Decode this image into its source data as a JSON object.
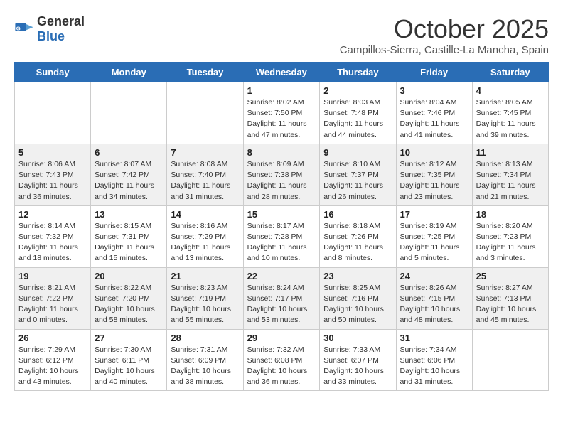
{
  "header": {
    "logo_general": "General",
    "logo_blue": "Blue",
    "month": "October 2025",
    "subtitle": "Campillos-Sierra, Castille-La Mancha, Spain"
  },
  "days_of_week": [
    "Sunday",
    "Monday",
    "Tuesday",
    "Wednesday",
    "Thursday",
    "Friday",
    "Saturday"
  ],
  "weeks": [
    [
      {
        "day": "",
        "info": ""
      },
      {
        "day": "",
        "info": ""
      },
      {
        "day": "",
        "info": ""
      },
      {
        "day": "1",
        "info": "Sunrise: 8:02 AM\nSunset: 7:50 PM\nDaylight: 11 hours and 47 minutes."
      },
      {
        "day": "2",
        "info": "Sunrise: 8:03 AM\nSunset: 7:48 PM\nDaylight: 11 hours and 44 minutes."
      },
      {
        "day": "3",
        "info": "Sunrise: 8:04 AM\nSunset: 7:46 PM\nDaylight: 11 hours and 41 minutes."
      },
      {
        "day": "4",
        "info": "Sunrise: 8:05 AM\nSunset: 7:45 PM\nDaylight: 11 hours and 39 minutes."
      }
    ],
    [
      {
        "day": "5",
        "info": "Sunrise: 8:06 AM\nSunset: 7:43 PM\nDaylight: 11 hours and 36 minutes."
      },
      {
        "day": "6",
        "info": "Sunrise: 8:07 AM\nSunset: 7:42 PM\nDaylight: 11 hours and 34 minutes."
      },
      {
        "day": "7",
        "info": "Sunrise: 8:08 AM\nSunset: 7:40 PM\nDaylight: 11 hours and 31 minutes."
      },
      {
        "day": "8",
        "info": "Sunrise: 8:09 AM\nSunset: 7:38 PM\nDaylight: 11 hours and 28 minutes."
      },
      {
        "day": "9",
        "info": "Sunrise: 8:10 AM\nSunset: 7:37 PM\nDaylight: 11 hours and 26 minutes."
      },
      {
        "day": "10",
        "info": "Sunrise: 8:12 AM\nSunset: 7:35 PM\nDaylight: 11 hours and 23 minutes."
      },
      {
        "day": "11",
        "info": "Sunrise: 8:13 AM\nSunset: 7:34 PM\nDaylight: 11 hours and 21 minutes."
      }
    ],
    [
      {
        "day": "12",
        "info": "Sunrise: 8:14 AM\nSunset: 7:32 PM\nDaylight: 11 hours and 18 minutes."
      },
      {
        "day": "13",
        "info": "Sunrise: 8:15 AM\nSunset: 7:31 PM\nDaylight: 11 hours and 15 minutes."
      },
      {
        "day": "14",
        "info": "Sunrise: 8:16 AM\nSunset: 7:29 PM\nDaylight: 11 hours and 13 minutes."
      },
      {
        "day": "15",
        "info": "Sunrise: 8:17 AM\nSunset: 7:28 PM\nDaylight: 11 hours and 10 minutes."
      },
      {
        "day": "16",
        "info": "Sunrise: 8:18 AM\nSunset: 7:26 PM\nDaylight: 11 hours and 8 minutes."
      },
      {
        "day": "17",
        "info": "Sunrise: 8:19 AM\nSunset: 7:25 PM\nDaylight: 11 hours and 5 minutes."
      },
      {
        "day": "18",
        "info": "Sunrise: 8:20 AM\nSunset: 7:23 PM\nDaylight: 11 hours and 3 minutes."
      }
    ],
    [
      {
        "day": "19",
        "info": "Sunrise: 8:21 AM\nSunset: 7:22 PM\nDaylight: 11 hours and 0 minutes."
      },
      {
        "day": "20",
        "info": "Sunrise: 8:22 AM\nSunset: 7:20 PM\nDaylight: 10 hours and 58 minutes."
      },
      {
        "day": "21",
        "info": "Sunrise: 8:23 AM\nSunset: 7:19 PM\nDaylight: 10 hours and 55 minutes."
      },
      {
        "day": "22",
        "info": "Sunrise: 8:24 AM\nSunset: 7:17 PM\nDaylight: 10 hours and 53 minutes."
      },
      {
        "day": "23",
        "info": "Sunrise: 8:25 AM\nSunset: 7:16 PM\nDaylight: 10 hours and 50 minutes."
      },
      {
        "day": "24",
        "info": "Sunrise: 8:26 AM\nSunset: 7:15 PM\nDaylight: 10 hours and 48 minutes."
      },
      {
        "day": "25",
        "info": "Sunrise: 8:27 AM\nSunset: 7:13 PM\nDaylight: 10 hours and 45 minutes."
      }
    ],
    [
      {
        "day": "26",
        "info": "Sunrise: 7:29 AM\nSunset: 6:12 PM\nDaylight: 10 hours and 43 minutes."
      },
      {
        "day": "27",
        "info": "Sunrise: 7:30 AM\nSunset: 6:11 PM\nDaylight: 10 hours and 40 minutes."
      },
      {
        "day": "28",
        "info": "Sunrise: 7:31 AM\nSunset: 6:09 PM\nDaylight: 10 hours and 38 minutes."
      },
      {
        "day": "29",
        "info": "Sunrise: 7:32 AM\nSunset: 6:08 PM\nDaylight: 10 hours and 36 minutes."
      },
      {
        "day": "30",
        "info": "Sunrise: 7:33 AM\nSunset: 6:07 PM\nDaylight: 10 hours and 33 minutes."
      },
      {
        "day": "31",
        "info": "Sunrise: 7:34 AM\nSunset: 6:06 PM\nDaylight: 10 hours and 31 minutes."
      },
      {
        "day": "",
        "info": ""
      }
    ]
  ]
}
